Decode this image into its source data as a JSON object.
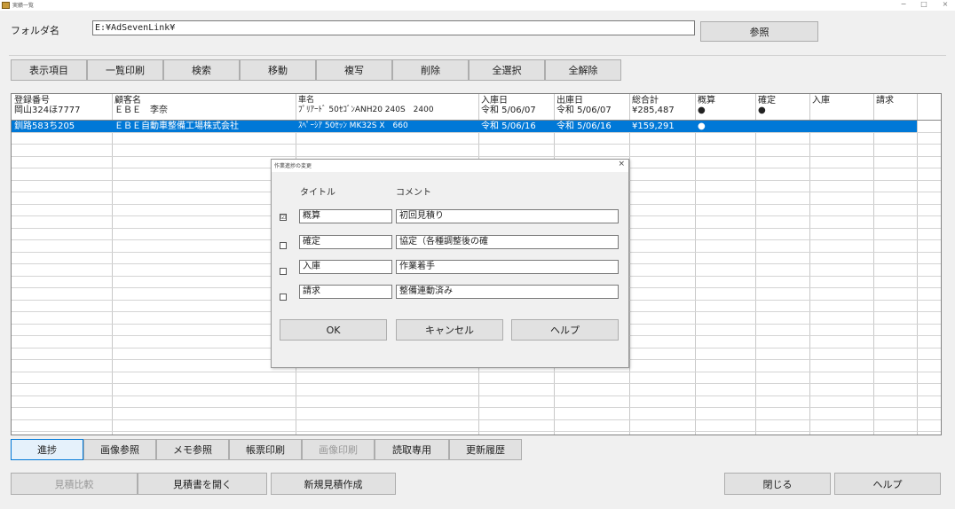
{
  "window": {
    "title": "実績一覧",
    "min": "−",
    "max": "□",
    "close": "×"
  },
  "folder": {
    "label": "フォルダ名",
    "value": "E:¥AdSevenLink¥",
    "browse": "参照"
  },
  "toolbar": [
    "表示項目",
    "一覧印刷",
    "検索",
    "移動",
    "複写",
    "削除",
    "全選択",
    "全解除"
  ],
  "grid": {
    "headers": [
      {
        "l1": "登録番号",
        "l2": "岡山324ほ7777"
      },
      {
        "l1": "顧客名",
        "l2": "ＥＢＥ　李奈"
      },
      {
        "l1": "車名",
        "l2": "ﾌﾟﾘｱｰﾄﾞ 50ｾｺﾞﾝANH20 240S　2400"
      },
      {
        "l1": "入庫日",
        "l2": "令和 5/06/07"
      },
      {
        "l1": "出庫日",
        "l2": "令和 5/06/07"
      },
      {
        "l1": "総合計",
        "l2": "¥285,487"
      },
      {
        "l1": "概算",
        "l2": "●"
      },
      {
        "l1": "確定",
        "l2": "●"
      },
      {
        "l1": "入庫",
        "l2": ""
      },
      {
        "l1": "請求",
        "l2": ""
      }
    ],
    "selected_row": [
      "釧路583ち205",
      "ＥＢＥ自動車整備工場株式会社",
      "ｽﾍﾟｰｼｱ 50ｾｯﾝ MK32S X　660",
      "令和 5/06/16",
      "令和 5/06/16",
      "¥159,291",
      "●",
      "",
      "",
      ""
    ]
  },
  "dialog": {
    "title": "作業進捗の変更",
    "close": "×",
    "col_title": "タイトル",
    "col_comment": "コメント",
    "rows": [
      {
        "checked": "☑",
        "title": "概算",
        "comment": "初回見積り"
      },
      {
        "checked": "",
        "title": "確定",
        "comment": "協定（各種調整後の確"
      },
      {
        "checked": "",
        "title": "入庫",
        "comment": "作業着手"
      },
      {
        "checked": "",
        "title": "請求",
        "comment": "整備連動済み"
      }
    ],
    "ok": "OK",
    "cancel": "キャンセル",
    "help": "ヘルプ"
  },
  "bottom_tabs": [
    "進捗",
    "画像参照",
    "メモ参照",
    "帳票印刷",
    "画像印刷",
    "読取専用",
    "更新履歴"
  ],
  "footer": {
    "compare": "見積比較",
    "open": "見積書を開く",
    "new": "新規見積作成",
    "close": "閉じる",
    "help": "ヘルプ"
  },
  "colors": {
    "selection": "#0078d7",
    "face": "#f0f0f0",
    "button": "#e1e1e1"
  }
}
